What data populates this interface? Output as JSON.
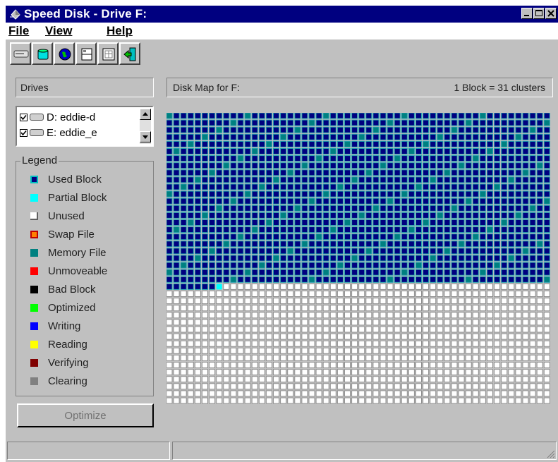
{
  "window": {
    "title": "Speed Disk - Drive F:"
  },
  "menu": {
    "file": "File",
    "view": "View",
    "help": "Help"
  },
  "toolbar": [
    {
      "icon": "drive-icon"
    },
    {
      "icon": "cylinder-icon"
    },
    {
      "icon": "globe-icon"
    },
    {
      "icon": "document-icon"
    },
    {
      "icon": "calendar-icon"
    },
    {
      "icon": "exit-icon"
    }
  ],
  "drives": {
    "header": "Drives",
    "items": [
      {
        "label": "D: eddie-d",
        "checked": true
      },
      {
        "label": "E: eddie_e",
        "checked": true
      }
    ]
  },
  "legend": {
    "title": "Legend",
    "items": [
      {
        "label": "Used Block",
        "color": "#000080"
      },
      {
        "label": "Partial Block",
        "color": "#00ffff"
      },
      {
        "label": "Unused",
        "color": "#ffffff"
      },
      {
        "label": "Swap File",
        "color": "#ff8000"
      },
      {
        "label": "Memory File",
        "color": "#008080"
      },
      {
        "label": "Unmoveable",
        "color": "#ff0000"
      },
      {
        "label": "Bad Block",
        "color": "#000000"
      },
      {
        "label": "Optimized",
        "color": "#00ff00"
      },
      {
        "label": "Writing",
        "color": "#0000ff"
      },
      {
        "label": "Reading",
        "color": "#ffff00"
      },
      {
        "label": "Verifying",
        "color": "#800000"
      },
      {
        "label": "Clearing",
        "color": "#808080"
      }
    ]
  },
  "optimize_label": "Optimize",
  "disk_map": {
    "title": "Disk Map for F:",
    "scale": "1 Block = 31 clusters",
    "grid": {
      "columns": 54,
      "rows": 41,
      "used_blocks": 1303,
      "partial_block_index": 1303
    }
  }
}
